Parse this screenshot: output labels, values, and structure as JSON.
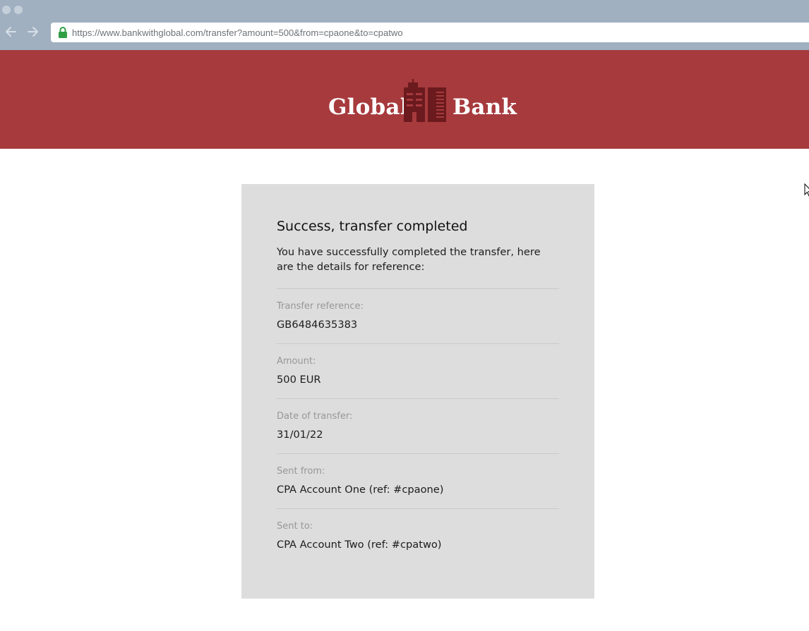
{
  "browser": {
    "url": "https://www.bankwithglobal.com/transfer?amount=500&from=cpaone&to=cpatwo",
    "back_icon": "arrow-left-icon",
    "forward_icon": "arrow-right-icon",
    "secure_icon": "lock-icon"
  },
  "header": {
    "brand_left": "Global",
    "brand_right": "Bank",
    "logo_icon": "building-icon",
    "background_color": "#a73a3d",
    "logo_color": "#6b1a1d"
  },
  "confirmation": {
    "title": "Success, transfer completed",
    "intro": "You have successfully completed the transfer, here are the details for reference:",
    "details": [
      {
        "label": "Transfer reference:",
        "value": "GB6484635383"
      },
      {
        "label": "Amount:",
        "value": "500 EUR"
      },
      {
        "label": "Date of transfer:",
        "value": "31/01/22"
      },
      {
        "label": "Sent from:",
        "value": "CPA Account One (ref: #cpaone)"
      },
      {
        "label": "Sent to:",
        "value": "CPA Account Two (ref: #cpatwo)"
      }
    ]
  }
}
